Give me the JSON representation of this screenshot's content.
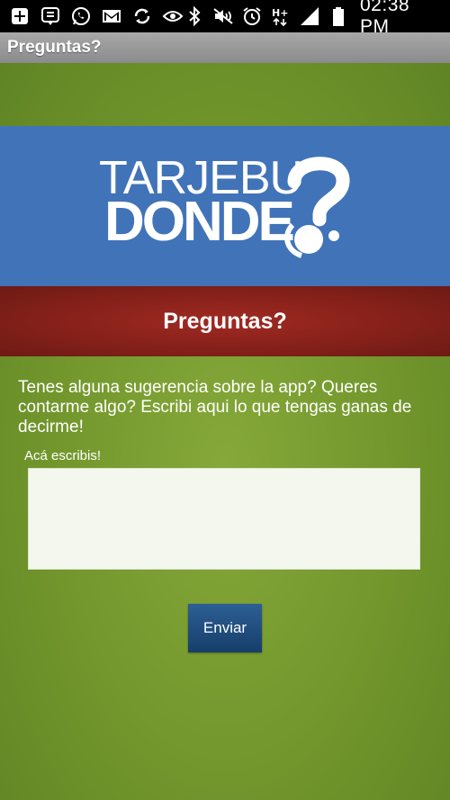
{
  "status_bar": {
    "time": "02:38 PM",
    "network": "H+",
    "left_icons": [
      "add-box-icon",
      "chat-bubble-icon",
      "whatsapp-icon",
      "gmail-icon",
      "sync-icon",
      "eye-icon"
    ],
    "right_icons": [
      "bluetooth-icon",
      "mute-icon",
      "alarm-icon",
      "network-icon",
      "signal-icon",
      "battery-icon"
    ]
  },
  "action_bar": {
    "title": "Preguntas?"
  },
  "logo": {
    "line1": "TARJEBU",
    "line2": "DONDE"
  },
  "section": {
    "title": "Preguntas?"
  },
  "form": {
    "intro": "Tenes alguna sugerencia sobre la app? Queres contarme algo? Escribi aqui lo que tengas ganas de decirme!",
    "label": "Acá escribis!",
    "value": "",
    "submit_label": "Enviar"
  },
  "colors": {
    "status_bar": "#000000",
    "action_bar": "#9a9a9a",
    "background": "#72962c",
    "logo_band": "#4173b8",
    "section_band": "#8a221b",
    "button": "#1f4a7d",
    "textarea": "#f4f7ee"
  }
}
